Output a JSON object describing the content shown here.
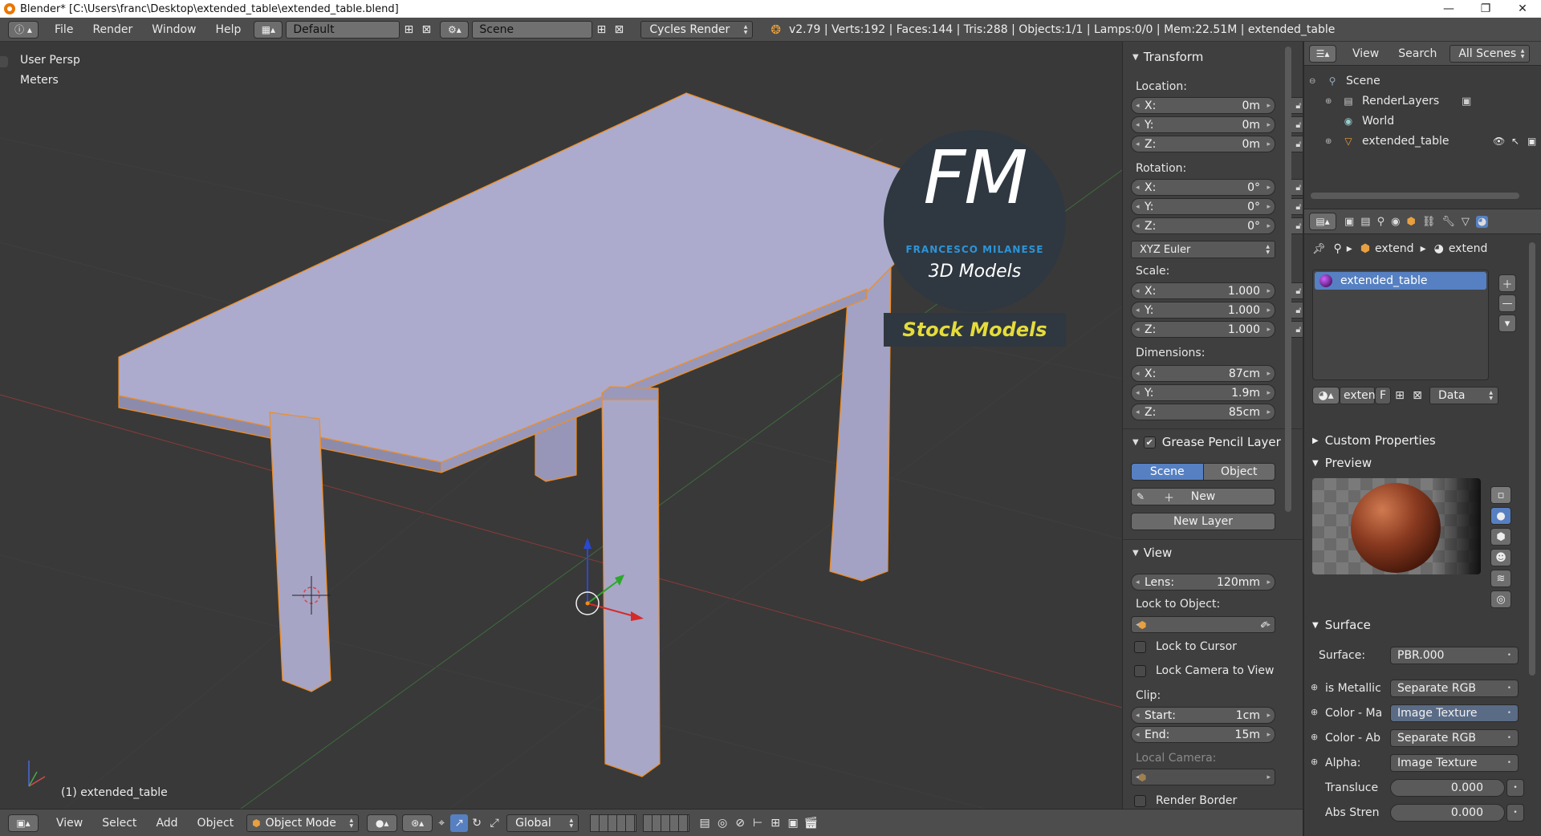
{
  "window": {
    "title": "Blender* [C:\\Users\\franc\\Desktop\\extended_table\\extended_table.blend]",
    "min_glyph": "—",
    "max_glyph": "❐",
    "close_glyph": "✕"
  },
  "topbar": {
    "menus": [
      "File",
      "Render",
      "Window",
      "Help"
    ],
    "layout": "Default",
    "scene": "Scene",
    "engine": "Cycles Render",
    "stats": "v2.79 | Verts:192 | Faces:144 | Tris:288 | Objects:1/1 | Lamps:0/0 | Mem:22.51M | extended_table"
  },
  "viewport": {
    "view_name": "User Persp",
    "units": "Meters",
    "object_label": "(1) extended_table",
    "logo": {
      "letters": "FM",
      "name": "FRANCESCO MILANESE",
      "models": "3D Models",
      "banner": "Stock Models"
    }
  },
  "npanel": {
    "transform": {
      "title": "Transform",
      "location_label": "Location:",
      "location": [
        {
          "axis": "X:",
          "value": "0m"
        },
        {
          "axis": "Y:",
          "value": "0m"
        },
        {
          "axis": "Z:",
          "value": "0m"
        }
      ],
      "rotation_label": "Rotation:",
      "rotation": [
        {
          "axis": "X:",
          "value": "0°"
        },
        {
          "axis": "Y:",
          "value": "0°"
        },
        {
          "axis": "Z:",
          "value": "0°"
        }
      ],
      "rotation_mode": "XYZ Euler",
      "scale_label": "Scale:",
      "scale": [
        {
          "axis": "X:",
          "value": "1.000"
        },
        {
          "axis": "Y:",
          "value": "1.000"
        },
        {
          "axis": "Z:",
          "value": "1.000"
        }
      ],
      "dimensions_label": "Dimensions:",
      "dimensions": [
        {
          "axis": "X:",
          "value": "87cm"
        },
        {
          "axis": "Y:",
          "value": "1.9m"
        },
        {
          "axis": "Z:",
          "value": "85cm"
        }
      ]
    },
    "grease": {
      "title": "Grease Pencil Layer",
      "tab_scene": "Scene",
      "tab_object": "Object",
      "new_label": "New",
      "new_layer_label": "New Layer"
    },
    "view": {
      "title": "View",
      "lens_label": "Lens:",
      "lens_value": "120mm",
      "lock_object_label": "Lock to Object:",
      "lock_cursor_label": "Lock to Cursor",
      "lock_camera_label": "Lock Camera to View",
      "clip_label": "Clip:",
      "clip_start_label": "Start:",
      "clip_start_value": "1cm",
      "clip_end_label": "End:",
      "clip_end_value": "15m",
      "local_camera_label": "Local Camera:",
      "render_border_label": "Render Border"
    }
  },
  "outliner": {
    "view_label": "View",
    "search_label": "Search",
    "filter": "All Scenes",
    "items": [
      {
        "label": "Scene"
      },
      {
        "label": "RenderLayers"
      },
      {
        "label": "World"
      },
      {
        "label": "extended_table"
      }
    ]
  },
  "properties": {
    "breadcrumb_1": "extend",
    "breadcrumb_2": "extend",
    "material_slot": "extended_table",
    "material_field": "exten",
    "material_f": "F",
    "link_mode": "Data",
    "custom_props": "Custom Properties",
    "preview": "Preview",
    "surface_title": "Surface",
    "surface_label": "Surface:",
    "surface_value": "PBR.000",
    "rows": [
      {
        "label": "is Metallic",
        "value": "Separate RGB",
        "style": "dark"
      },
      {
        "label": "Color - Ma",
        "value": "Image Texture",
        "style": "blue"
      },
      {
        "label": "Color - Ab",
        "value": "Separate RGB",
        "style": "dark"
      },
      {
        "label": "Alpha:",
        "value": "Image Texture",
        "style": "dark"
      }
    ],
    "translucency_label": "Transluce",
    "translucency_value": "0.000",
    "abs_label": "Abs Stren",
    "abs_value": "0.000"
  },
  "bottombar": {
    "menus": [
      "View",
      "Select",
      "Add",
      "Object"
    ],
    "mode": "Object Mode",
    "orientation": "Global"
  },
  "colors": {
    "viewport_bg": "#393939",
    "table": "#a7a6c8",
    "selection": "#f28c1e",
    "logo_circle": "#2f3840",
    "logo_text": "#2c94d9",
    "banner_text": "#e5dc3a",
    "selected_blue": "#5680c2"
  }
}
